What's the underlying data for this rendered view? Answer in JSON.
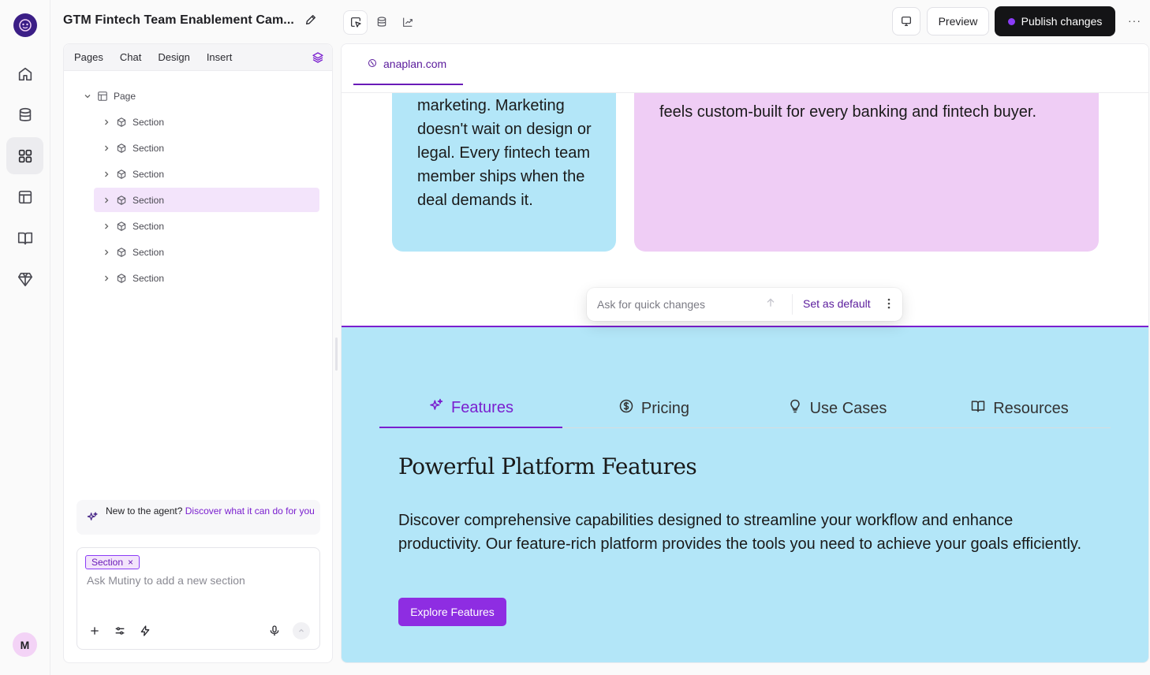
{
  "user": {
    "initial": "M"
  },
  "header": {
    "title": "GTM Fintech Team Enablement Cam...",
    "preview_label": "Preview",
    "publish_label": "Publish changes",
    "more_label": "···"
  },
  "left_panel": {
    "tabs": [
      "Pages",
      "Chat",
      "Design",
      "Insert"
    ],
    "tree": {
      "root": "Page",
      "sections": [
        "Section",
        "Section",
        "Section",
        "Section",
        "Section",
        "Section",
        "Section"
      ],
      "selected_index": 3
    },
    "hint": {
      "prefix": "New to the agent? ",
      "link": "Discover what it can do for you"
    },
    "composer": {
      "chip": "Section",
      "chip_close": "×",
      "placeholder": "Ask Mutiny to add a new section"
    }
  },
  "canvas": {
    "url_tab": "anaplan.com",
    "blue_card_text": "marketing. Marketing doesn't wait on design or legal. Every fintech team member ships when the deal demands it.",
    "pink_card_text": "feels custom-built for every banking and fintech buyer.",
    "quickbar": {
      "placeholder": "Ask for quick changes",
      "default_label": "Set as default"
    },
    "tabs": [
      {
        "label": "Features",
        "icon": "sparkle-icon"
      },
      {
        "label": "Pricing",
        "icon": "dollar-circle-icon"
      },
      {
        "label": "Use Cases",
        "icon": "lightbulb-icon"
      },
      {
        "label": "Resources",
        "icon": "book-icon"
      }
    ],
    "section_title": "Powerful Platform Features",
    "section_body": "Discover comprehensive capabilities designed to streamline your workflow and enhance productivity. Our feature-rich platform provides the tools you need to achieve your goals efficiently.",
    "cta_label": "Explore Features"
  },
  "colors": {
    "accent": "#7a1fcf",
    "card_blue": "#b3e6f8",
    "card_pink": "#efcdf5",
    "publish_bg": "#141416"
  }
}
